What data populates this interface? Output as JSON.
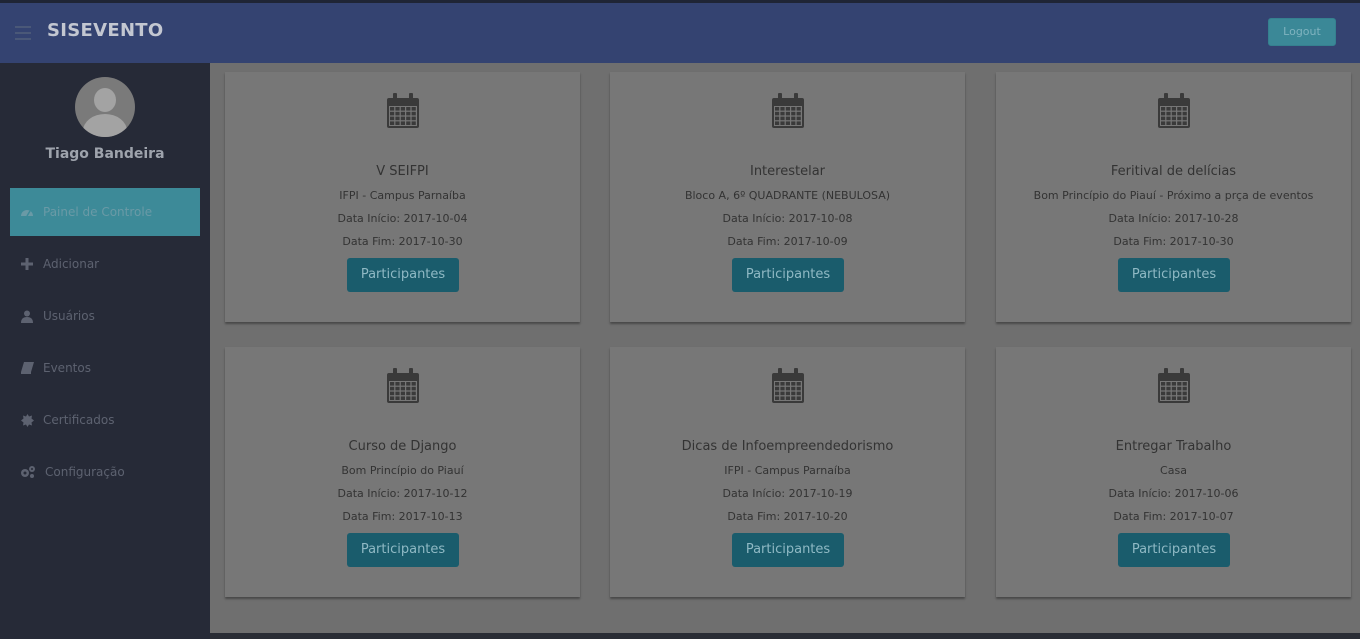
{
  "header": {
    "brand": "SISEVENTO",
    "logout_label": "Logout"
  },
  "user": {
    "name": "Tiago Bandeira"
  },
  "sidebar": {
    "items": [
      {
        "label": "Painel de Controle",
        "icon": "dashboard-icon",
        "active": true
      },
      {
        "label": "Adicionar",
        "icon": "plus-icon"
      },
      {
        "label": "Usuários",
        "icon": "user-icon"
      },
      {
        "label": "Eventos",
        "icon": "book-icon"
      },
      {
        "label": "Certificados",
        "icon": "certificate-icon"
      },
      {
        "label": "Configuração",
        "icon": "gears-icon"
      }
    ]
  },
  "events": [
    {
      "title": "V SEIFPI",
      "location": "IFPI - Campus Parnaíba",
      "start": "Data Início: 2017-10-04",
      "end": "Data Fim: 2017-10-30",
      "button": "Participantes"
    },
    {
      "title": "Interestelar",
      "location": "Bloco A, 6º QUADRANTE (NEBULOSA)",
      "start": "Data Início: 2017-10-08",
      "end": "Data Fim: 2017-10-09",
      "button": "Participantes"
    },
    {
      "title": "Feritival de delícias",
      "location": "Bom Princípio do Piauí - Próximo a prça de eventos",
      "start": "Data Início: 2017-10-28",
      "end": "Data Fim: 2017-10-30",
      "button": "Participantes"
    },
    {
      "title": "Curso de Django",
      "location": "Bom Princípio do Piauí",
      "start": "Data Início: 2017-10-12",
      "end": "Data Fim: 2017-10-13",
      "button": "Participantes"
    },
    {
      "title": "Dicas de Infoempreendedorismo",
      "location": "IFPI - Campus Parnaíba",
      "start": "Data Início: 2017-10-19",
      "end": "Data Fim: 2017-10-20",
      "button": "Participantes"
    },
    {
      "title": "Entregar Trabalho",
      "location": "Casa",
      "start": "Data Início: 2017-10-06",
      "end": "Data Fim: 2017-10-07",
      "button": "Participantes"
    }
  ]
}
